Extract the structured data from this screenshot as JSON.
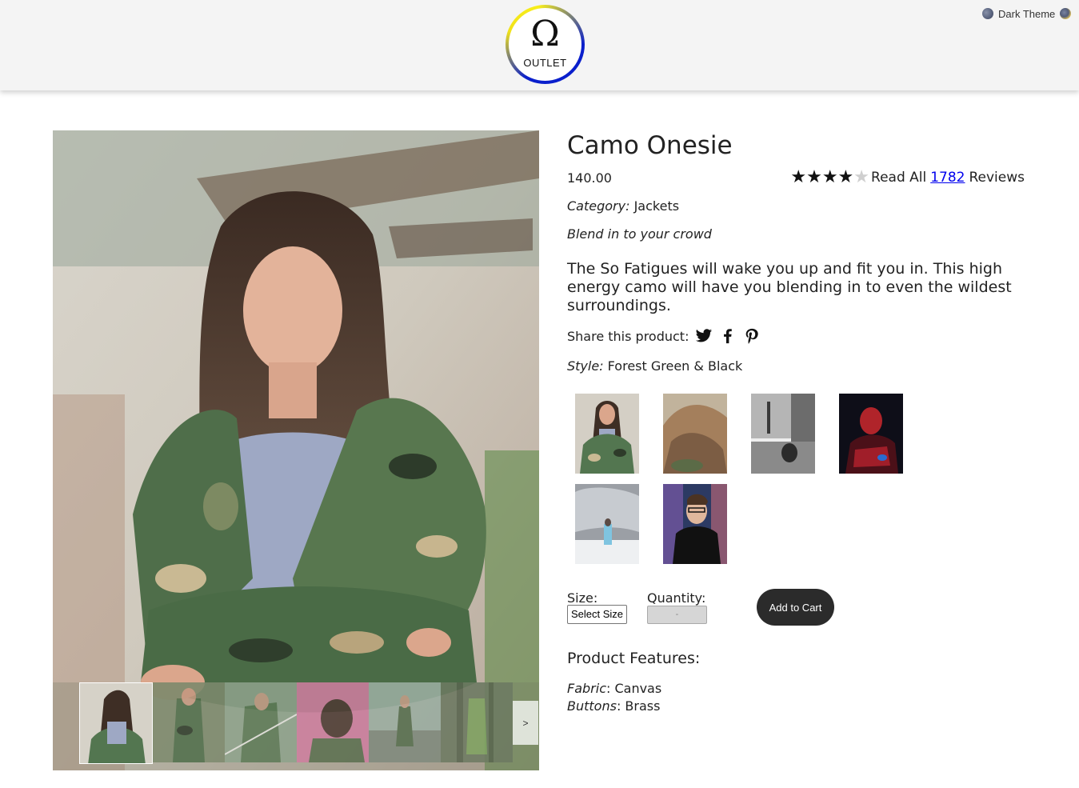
{
  "header": {
    "logo_symbol": "Ω",
    "logo_text": "OUTLET",
    "theme_toggle_label": "Dark Theme"
  },
  "product": {
    "title": "Camo Onesie",
    "price": "140.00",
    "rating": {
      "stars_filled": 4,
      "stars_total": 5,
      "prefix": "Read All",
      "count": "1782",
      "suffix": "Reviews"
    },
    "category_label": "Category:",
    "category": "Jackets",
    "slogan": "Blend in to your crowd",
    "description": "The So Fatigues will wake you up and fit you in. This high energy camo will have you blending in to even the wildest surroundings.",
    "share_label": "Share this product:",
    "share_icons": [
      "twitter-icon",
      "facebook-icon",
      "pinterest-icon"
    ],
    "style_label": "Style:",
    "style": "Forest Green & Black",
    "style_count": 6,
    "size_label": "Size:",
    "size_select": "Select Size",
    "quantity_label": "Quantity:",
    "quantity_select": "-",
    "add_to_cart": "Add to Cart",
    "features_title": "Product Features:",
    "features": [
      {
        "name": "Fabric",
        "value": "Canvas"
      },
      {
        "name": "Buttons",
        "value": "Brass"
      }
    ]
  },
  "gallery": {
    "next_label": ">"
  },
  "colors": {
    "logo_ring_blue": "#0a1fcc",
    "logo_ring_yellow": "#f1e21a",
    "button_dark": "#2b2b2b",
    "link": "#0000ee"
  }
}
